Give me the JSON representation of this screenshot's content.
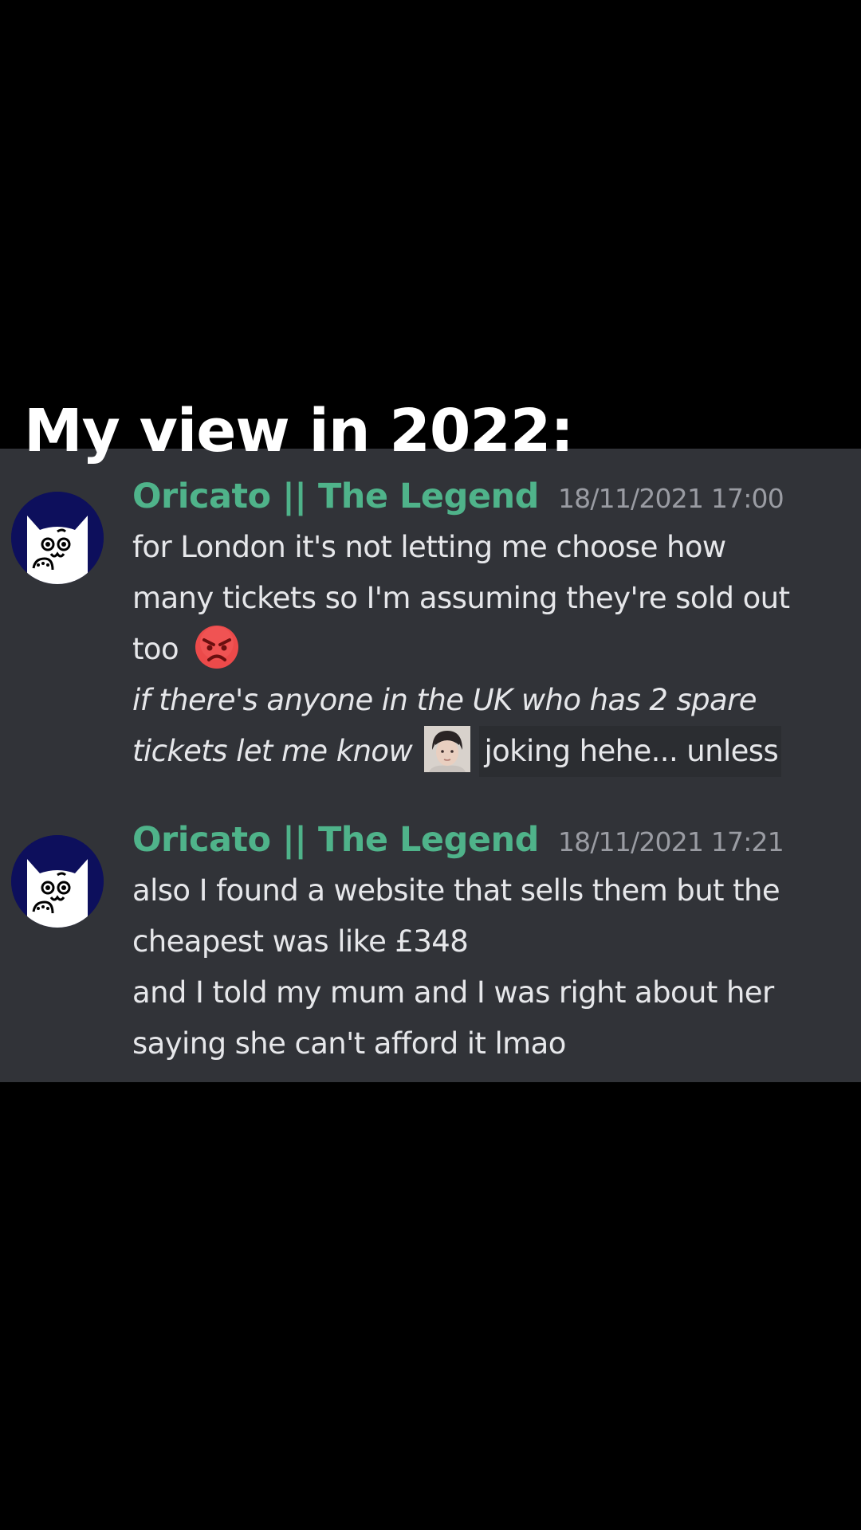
{
  "caption": "My view in 2022:",
  "messages": [
    {
      "username": "Oricato || The Legend",
      "timestamp": "18/11/2021 17:00",
      "avatar_icon": "white-cat-avatar-icon",
      "lines": [
        "for London it's not letting me choose how",
        "many tickets so I'm assuming they're sold out",
        "too"
      ],
      "emoji": "angry-face-emoji-icon",
      "italic_lines": [
        "if there's anyone in the UK who has 2 spare",
        "tickets let me know"
      ],
      "custom_emoji": "photo-face-emoji-icon",
      "trailing_text": "joking hehe... unless"
    },
    {
      "username": "Oricato || The Legend",
      "timestamp": "18/11/2021 17:21",
      "avatar_icon": "white-cat-avatar-icon",
      "lines": [
        "also I found a website that sells them but the",
        "cheapest was like £348",
        "and I told my mum and I was right about her",
        "saying she can't afford it lmao"
      ]
    }
  ],
  "colors": {
    "background": "#000000",
    "panel": "#313338",
    "username": "#4fb38a",
    "timestamp": "#9a9ca3",
    "message_text": "#e6e7ea",
    "avatar_bg": "#0d0f5c"
  }
}
